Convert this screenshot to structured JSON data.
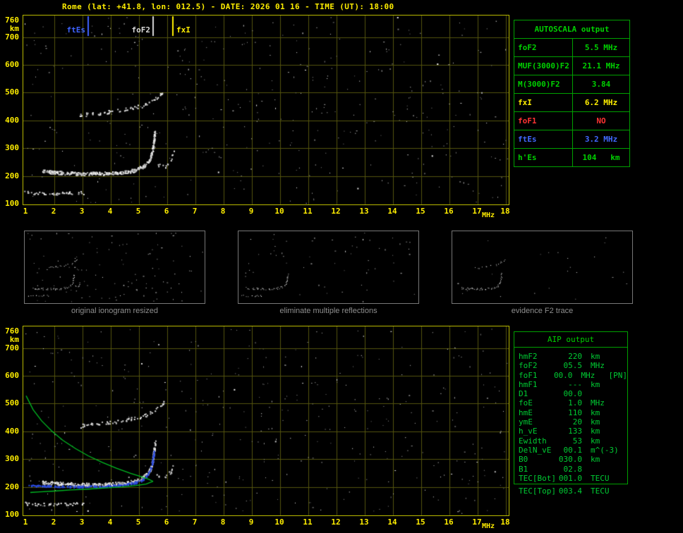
{
  "window": {
    "title": "Rome (lat: +41.8, lon: 012.5) - DATE: 2026 01 16 - TIME (UT): 18:00"
  },
  "colors": {
    "background": "#000000",
    "plot_border": "#b8b800",
    "grid": "#54540e",
    "axis_text": "#ffee00",
    "profile_green": "#00bb22",
    "fitted_blue": "#2b4be0",
    "table_border": "#00a000",
    "row_colors": {
      "green": "#00d000",
      "yellow": "#ffee00",
      "red": "#ff3333",
      "blue": "#4169ff"
    }
  },
  "axes": {
    "x_unit": "MHz",
    "y_unit": "km",
    "x_ticks": [
      1,
      2,
      3,
      4,
      5,
      6,
      7,
      8,
      9,
      10,
      11,
      12,
      13,
      14,
      15,
      16,
      17,
      18
    ],
    "y_ticks": [
      760,
      700,
      600,
      500,
      400,
      300,
      200,
      100
    ],
    "x_range_mhz": [
      1,
      18
    ],
    "y_range_km": [
      100,
      760
    ]
  },
  "autoscala_table": {
    "title": "AUTOSCALA output",
    "rows": [
      {
        "label": "foF2",
        "value": "5.5 MHz",
        "color": "green"
      },
      {
        "label": "MUF(3000)F2",
        "value": "21.1 MHz",
        "color": "green"
      },
      {
        "label": "M(3000)F2",
        "value": "3.84",
        "color": "green"
      },
      {
        "label": "fxI",
        "value": "6.2 MHz",
        "color": "yellow"
      },
      {
        "label": "foF1",
        "value": "NO",
        "color": "red"
      },
      {
        "label": "ftEs",
        "value": "3.2 MHz",
        "color": "blue"
      },
      {
        "label": "h'Es",
        "value": "104   km",
        "color": "green"
      }
    ]
  },
  "thumbnails": [
    {
      "label": "original ionogram resized"
    },
    {
      "label": "eliminate multiple reflections"
    },
    {
      "label": "evidence F2 trace"
    }
  ],
  "aip_panel": {
    "title": "AIP output",
    "rows": [
      {
        "name": "hmF2",
        "value": "220",
        "unit": "km",
        "extra": ""
      },
      {
        "name": "foF2",
        "value": "05.5",
        "unit": "MHz",
        "extra": ""
      },
      {
        "name": "foF1",
        "value": "00.0",
        "unit": "MHz",
        "extra": "[PN]"
      },
      {
        "name": "hmF1",
        "value": "---",
        "unit": "km",
        "extra": ""
      },
      {
        "name": "D1",
        "value": "00.0",
        "unit": "",
        "extra": ""
      },
      {
        "name": "foE",
        "value": "1.0",
        "unit": "MHz",
        "extra": ""
      },
      {
        "name": "hmE",
        "value": "110",
        "unit": "km",
        "extra": ""
      },
      {
        "name": "ymE",
        "value": "20",
        "unit": "km",
        "extra": ""
      },
      {
        "name": "h_vE",
        "value": "133",
        "unit": "km",
        "extra": ""
      },
      {
        "name": "Ewidth",
        "value": "53",
        "unit": "km",
        "extra": ""
      },
      {
        "name": "DelN_vE",
        "value": "00.1",
        "unit": "m^(-3)",
        "extra": ""
      },
      {
        "name": "B0",
        "value": "030.0",
        "unit": "km",
        "extra": ""
      },
      {
        "name": "B1",
        "value": "02.8",
        "unit": "",
        "extra": ""
      },
      {
        "name": "TEC[Bot]",
        "value": "001.0",
        "unit": "TECU",
        "extra": ""
      }
    ],
    "footer_row": {
      "name": "TEC[Top]",
      "value": "003.4",
      "unit": "TECU"
    }
  },
  "chart_data": [
    {
      "id": "ionogram-scaled",
      "type": "scatter",
      "xlabel": "MHz",
      "ylabel": "km",
      "xlim": [
        1,
        18
      ],
      "ylim": [
        100,
        760
      ],
      "grid": true,
      "markers": [
        {
          "label": "ftEs",
          "freq_mhz": 3.2,
          "color": "#3e63ff"
        },
        {
          "label": "foF2",
          "freq_mhz": 5.5,
          "color": "#d8d8d8"
        },
        {
          "label": "fxI",
          "freq_mhz": 6.2,
          "color": "#ffee00"
        }
      ],
      "traces": [
        {
          "name": "Es-layer-trace",
          "points_f_h": [
            [
              0.95,
              142
            ],
            [
              1.3,
              139
            ],
            [
              1.7,
              138
            ],
            [
              2.1,
              139
            ],
            [
              2.5,
              140
            ],
            [
              2.9,
              141
            ],
            [
              3.05,
              140
            ]
          ]
        },
        {
          "name": "F-region-trace",
          "points_f_h": [
            [
              1.55,
              220
            ],
            [
              1.9,
              215
            ],
            [
              2.4,
              212
            ],
            [
              2.9,
              210
            ],
            [
              3.4,
              210
            ],
            [
              3.9,
              211
            ],
            [
              4.3,
              214
            ],
            [
              4.7,
              219
            ],
            [
              4.95,
              226
            ],
            [
              5.15,
              236
            ],
            [
              5.3,
              250
            ],
            [
              5.4,
              268
            ],
            [
              5.47,
              295
            ],
            [
              5.52,
              330
            ],
            [
              5.55,
              365
            ]
          ]
        },
        {
          "name": "second-hop-trace",
          "points_f_h": [
            [
              2.85,
              420
            ],
            [
              3.3,
              425
            ],
            [
              3.8,
              430
            ],
            [
              4.3,
              437
            ],
            [
              4.7,
              445
            ],
            [
              5.1,
              455
            ],
            [
              5.4,
              468
            ],
            [
              5.65,
              485
            ],
            [
              5.85,
              505
            ]
          ]
        },
        {
          "name": "x-mode-trace",
          "points_f_h": [
            [
              5.62,
              248
            ],
            [
              5.8,
              236
            ],
            [
              5.95,
              238
            ],
            [
              6.1,
              252
            ],
            [
              6.2,
              285
            ]
          ]
        }
      ]
    },
    {
      "id": "ionogram-inversion",
      "type": "scatter",
      "xlabel": "MHz",
      "ylabel": "km",
      "xlim": [
        1,
        18
      ],
      "ylim": [
        100,
        760
      ],
      "grid": true,
      "echo_traces": "same as ionogram-scaled",
      "profile_topside_f_h": [
        [
          1.0,
          528
        ],
        [
          1.25,
          478
        ],
        [
          1.55,
          438
        ],
        [
          1.9,
          402
        ],
        [
          2.3,
          368
        ],
        [
          2.75,
          338
        ],
        [
          3.2,
          312
        ],
        [
          3.7,
          288
        ],
        [
          4.2,
          267
        ],
        [
          4.7,
          249
        ],
        [
          5.1,
          236
        ],
        [
          5.35,
          227
        ],
        [
          5.5,
          220
        ]
      ],
      "profile_bottomside_f_h": [
        [
          5.5,
          220
        ],
        [
          5.25,
          210
        ],
        [
          4.9,
          205
        ],
        [
          4.4,
          200
        ],
        [
          3.8,
          196
        ],
        [
          3.2,
          192
        ],
        [
          2.6,
          189
        ],
        [
          2.0,
          185
        ],
        [
          1.5,
          182
        ],
        [
          1.15,
          180
        ]
      ],
      "fitted_trace_f_h": [
        [
          1.1,
          206
        ],
        [
          1.7,
          204
        ],
        [
          2.3,
          203
        ],
        [
          2.9,
          202
        ],
        [
          3.5,
          203
        ],
        [
          4.0,
          205
        ],
        [
          4.4,
          209
        ],
        [
          4.8,
          215
        ],
        [
          5.05,
          223
        ],
        [
          5.2,
          234
        ],
        [
          5.32,
          250
        ],
        [
          5.42,
          272
        ],
        [
          5.48,
          300
        ],
        [
          5.52,
          330
        ]
      ]
    }
  ]
}
